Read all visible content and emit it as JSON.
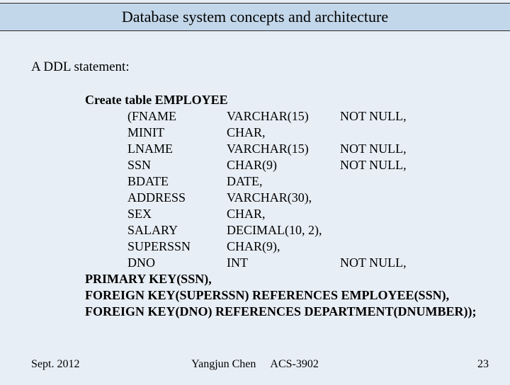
{
  "header": {
    "title": "Database system concepts and architecture"
  },
  "intro": "A DDL statement:",
  "ddl": {
    "create_line": "Create table EMPLOYEE",
    "open_paren": "(",
    "columns": [
      {
        "name": "FNAME",
        "type": "VARCHAR(15)",
        "constraint": "NOT NULL,"
      },
      {
        "name": "MINIT",
        "type": "CHAR,",
        "constraint": ""
      },
      {
        "name": "LNAME",
        "type": "VARCHAR(15)",
        "constraint": "NOT NULL,"
      },
      {
        "name": "SSN",
        "type": "CHAR(9)",
        "constraint": "NOT NULL,"
      },
      {
        "name": "BDATE",
        "type": "DATE,",
        "constraint": ""
      },
      {
        "name": "ADDRESS",
        "type": "VARCHAR(30),",
        "constraint": ""
      },
      {
        "name": "SEX",
        "type": "CHAR,",
        "constraint": ""
      },
      {
        "name": "SALARY",
        "type": "DECIMAL(10, 2),",
        "constraint": ""
      },
      {
        "name": "SUPERSSN",
        "type": "CHAR(9),",
        "constraint": ""
      },
      {
        "name": "DNO",
        "type": "INT",
        "constraint": "NOT NULL,"
      }
    ],
    "keys": [
      "PRIMARY KEY(SSN),",
      "FOREIGN KEY(SUPERSSN) REFERENCES EMPLOYEE(SSN),",
      "FOREIGN KEY(DNO) REFERENCES DEPARTMENT(DNUMBER));"
    ]
  },
  "footer": {
    "date": "Sept. 2012",
    "author": "Yangjun Chen",
    "course": "ACS-3902",
    "page": "23"
  }
}
